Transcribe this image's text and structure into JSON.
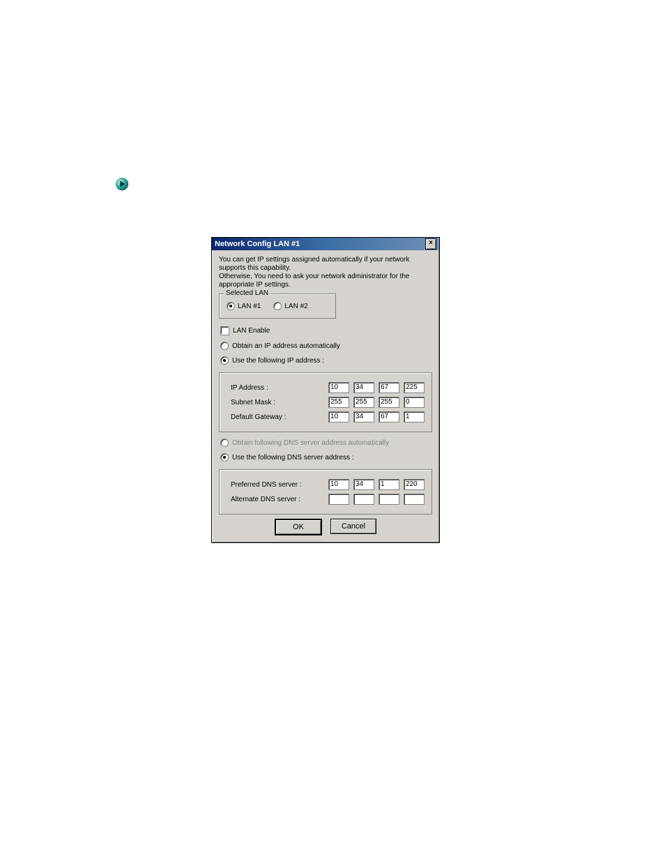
{
  "dialog": {
    "title": "Network Config LAN #1",
    "intro_line1": "You can get IP settings assigned automatically if your network supports this capability.",
    "intro_line2": "Otherwise, You need to ask your network administrator for the appropriate IP settings.",
    "selected_lan_legend": "Selected LAN",
    "lan_option1": "LAN #1",
    "lan_option2": "LAN #2",
    "lan_selected": 1,
    "lan_enable_label": "LAN Enable",
    "ip_mode_auto": "Obtain an IP address automatically",
    "ip_mode_manual": "Use the following IP address :",
    "ip_rows": {
      "ip_label": "IP Address :",
      "ip": [
        "10",
        "34",
        "67",
        "225"
      ],
      "mask_label": "Subnet Mask :",
      "mask": [
        "255",
        "255",
        "255",
        "0"
      ],
      "gw_label": "Default Gateway :",
      "gw": [
        "10",
        "34",
        "67",
        "1"
      ]
    },
    "dns_mode_auto": "Obtain following DNS server address automatically",
    "dns_mode_manual": "Use the following DNS server address :",
    "dns_rows": {
      "pref_label": "Preferred DNS server :",
      "pref": [
        "10",
        "34",
        "1",
        "220"
      ],
      "alt_label": "Alternate DNS server :",
      "alt": [
        "",
        "",
        "",
        ""
      ]
    },
    "ok": "OK",
    "cancel": "Cancel",
    "close_glyph": "×"
  }
}
